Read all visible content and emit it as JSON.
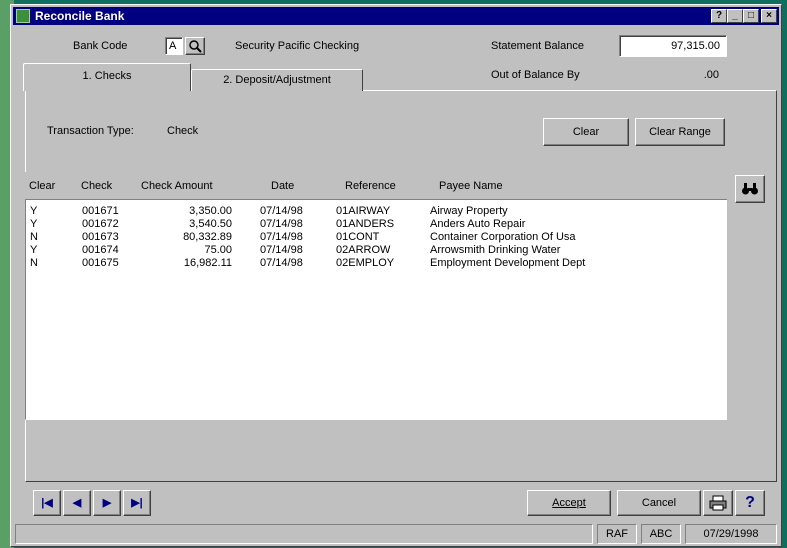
{
  "window": {
    "title": "Reconcile Bank",
    "controls": [
      "?",
      "_",
      "□",
      "×"
    ]
  },
  "header": {
    "bank_code_label": "Bank Code",
    "bank_code_value": "A",
    "bank_name": "Security Pacific Checking",
    "statement_balance_label": "Statement Balance",
    "statement_balance_value": "97,315.00",
    "out_of_balance_label": "Out of Balance By",
    "out_of_balance_value": ".00"
  },
  "tabs": [
    {
      "label": "1. Checks",
      "active": true
    },
    {
      "label": "2. Deposit/Adjustment",
      "active": false
    }
  ],
  "checks_tab": {
    "transaction_type_label": "Transaction Type:",
    "transaction_type_value": "Check",
    "clear_label": "Clear",
    "clear_range_label": "Clear Range"
  },
  "table": {
    "columns": [
      "Clear",
      "Check",
      "Check Amount",
      "Date",
      "Reference",
      "Payee Name"
    ],
    "rows": [
      {
        "clear": "Y",
        "check": "001671",
        "amount": "3,350.00",
        "date": "07/14/98",
        "reference": "01AIRWAY",
        "payee": "Airway Property"
      },
      {
        "clear": "Y",
        "check": "001672",
        "amount": "3,540.50",
        "date": "07/14/98",
        "reference": "01ANDERS",
        "payee": "Anders Auto Repair"
      },
      {
        "clear": "N",
        "check": "001673",
        "amount": "80,332.89",
        "date": "07/14/98",
        "reference": "01CONT",
        "payee": "Container Corporation Of Usa"
      },
      {
        "clear": "Y",
        "check": "001674",
        "amount": "75.00",
        "date": "07/14/98",
        "reference": "02ARROW",
        "payee": "Arrowsmith Drinking Water"
      },
      {
        "clear": "N",
        "check": "001675",
        "amount": "16,982.11",
        "date": "07/14/98",
        "reference": "02EMPLOY",
        "payee": "Employment Development Dept"
      }
    ]
  },
  "nav_buttons": [
    "|◀",
    "◀",
    "▶",
    "▶|"
  ],
  "footer": {
    "accept_label": "Accept",
    "cancel_label": "Cancel",
    "help_label": "?"
  },
  "status": {
    "user": "RAF",
    "company": "ABC",
    "date": "07/29/1998"
  },
  "icons": {
    "find": "binoculars-icon",
    "print": "printer-icon",
    "lookup": "magnifier-icon"
  }
}
